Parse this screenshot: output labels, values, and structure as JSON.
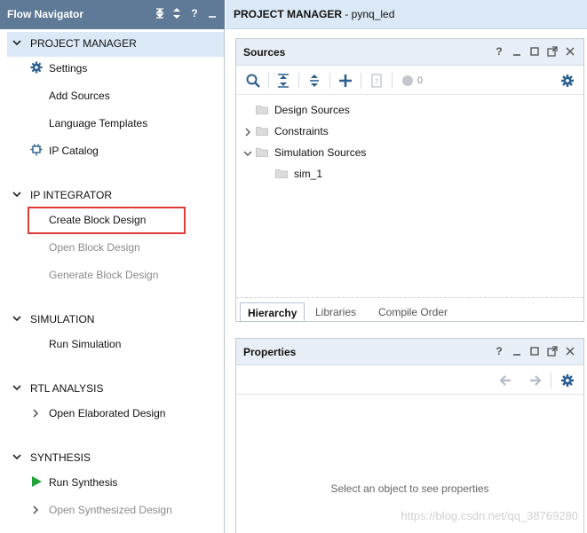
{
  "navigator": {
    "title": "Flow Navigator",
    "header_icons": [
      "collapse-all-icon",
      "sort-icon",
      "help-icon",
      "minimize-icon"
    ],
    "sections": [
      {
        "label": "PROJECT MANAGER",
        "items": [
          {
            "label": "Settings",
            "icon": "gear-icon",
            "enabled": true
          },
          {
            "label": "Add Sources",
            "enabled": true
          },
          {
            "label": "Language Templates",
            "enabled": true
          },
          {
            "label": "IP Catalog",
            "icon": "plug-icon",
            "enabled": true
          }
        ]
      },
      {
        "label": "IP INTEGRATOR",
        "items": [
          {
            "label": "Create Block Design",
            "enabled": true,
            "highlighted": true
          },
          {
            "label": "Open Block Design",
            "enabled": false
          },
          {
            "label": "Generate Block Design",
            "enabled": false
          }
        ]
      },
      {
        "label": "SIMULATION",
        "items": [
          {
            "label": "Run Simulation",
            "enabled": true
          }
        ]
      },
      {
        "label": "RTL ANALYSIS",
        "items": [
          {
            "label": "Open Elaborated Design",
            "enabled": true,
            "expandable": true
          }
        ]
      },
      {
        "label": "SYNTHESIS",
        "items": [
          {
            "label": "Run Synthesis",
            "icon": "play-icon",
            "enabled": true
          },
          {
            "label": "Open Synthesized Design",
            "enabled": false,
            "expandable": true
          }
        ]
      }
    ]
  },
  "main_header": {
    "section": "PROJECT MANAGER",
    "project": " - pynq_led"
  },
  "sources": {
    "title": "Sources",
    "status_count": "0",
    "tree": [
      {
        "label": "Design Sources",
        "expanded": null
      },
      {
        "label": "Constraints",
        "expanded": false
      },
      {
        "label": "Simulation Sources",
        "expanded": true
      },
      {
        "label": "sim_1",
        "child": true
      }
    ],
    "tabs": [
      {
        "label": "Hierarchy",
        "active": true
      },
      {
        "label": "Libraries",
        "active": false
      },
      {
        "label": "Compile Order",
        "active": false
      }
    ]
  },
  "properties": {
    "title": "Properties",
    "placeholder": "Select an object to see properties"
  },
  "watermark": "https://blog.csdn.net/qq_38769280",
  "colors": {
    "nav_header": "#5f7a96",
    "section_highlight": "#dbe8f6",
    "highlight_box": "#e03a3a",
    "toolbar_icon": "#2b5f8f",
    "run_green": "#22a33a"
  }
}
